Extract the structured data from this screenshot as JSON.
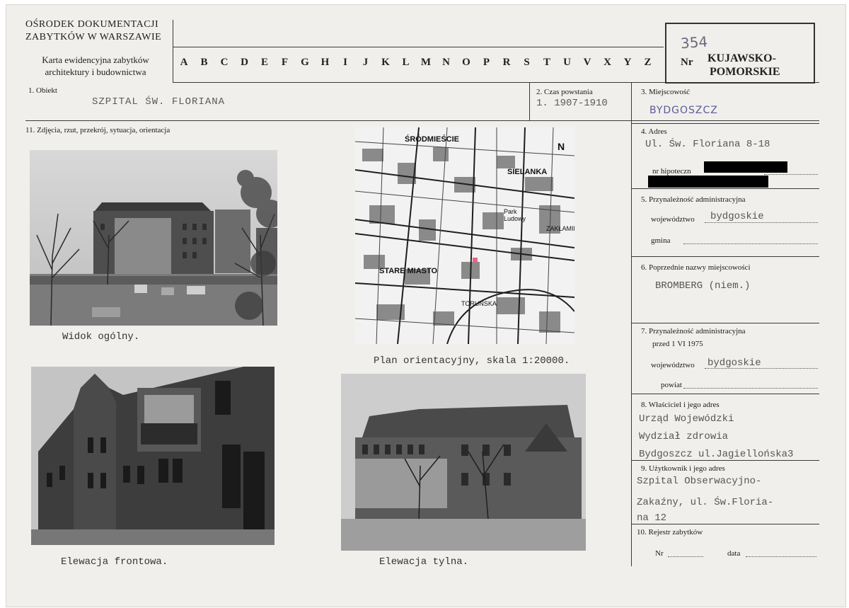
{
  "header": {
    "institution_line1": "OŚRODEK DOKUMENTACJI",
    "institution_line2": "ZABYTKÓW W WARSZAWIE",
    "card_type_line1": "Karta ewidencyjna zabytków",
    "card_type_line2": "architektury i budownictwa",
    "alphabet": [
      "A",
      "B",
      "C",
      "D",
      "E",
      "F",
      "G",
      "H",
      "I",
      "J",
      "K",
      "L",
      "M",
      "N",
      "O",
      "P",
      "R",
      "S",
      "T",
      "U",
      "V",
      "X",
      "Y",
      "Z"
    ],
    "nr_label": "Nr",
    "handwritten_number": "354",
    "region_line1": "KUJAWSKO-",
    "region_line2": "POMORSKIE"
  },
  "fields": {
    "obiekt_label": "1. Obiekt",
    "obiekt_value": "SZPITAL ŚW. FLORIANA",
    "czas_label": "2. Czas powstania",
    "czas_value": "1. 1907-1910",
    "miejscowosc_label": "3. Miejscowość",
    "miejscowosc_value": "BYDGOSZCZ",
    "zdjecia_label": "11. Zdjęcia, rzut, przekrój, sytuacja, orientacja",
    "adres_label": "4. Adres",
    "adres_value": "Ul. Św. Floriana 8-18",
    "hipoteczny_label": "nr hipoteczn",
    "przynaleznosc_label": "5. Przynależność administracyjna",
    "wojewodztwo_label": "województwo",
    "wojewodztwo_value": "bydgoskie",
    "gmina_label": "gmina",
    "poprzednie_label": "6. Poprzednie nazwy miejscowości",
    "poprzednie_value": "BROMBERG (niem.)",
    "przynaleznosc1975_label": "7. Przynależność administracyjna",
    "przed1975_label": "przed 1 VI 1975",
    "wojewodztwo2_label": "województwo",
    "wojewodztwo2_value": "bydgoskie",
    "powiat_label": "powiat",
    "wlasciciel_label": "8. Właściciel i jego adres",
    "wlasciciel_line1": "Urząd Wojewódzki",
    "wlasciciel_line2": "Wydział zdrowia",
    "wlasciciel_line3": "Bydgoszcz ul.Jagiellońska3",
    "uzytkownik_label": "9. Użytkownik i jego adres",
    "uzytkownik_line1": "Szpital Obserwacyjno-",
    "uzytkownik_line2": "Zakaźny, ul. Św.Floria-",
    "uzytkownik_line3": "na 12",
    "rejestr_label": "10. Rejestr zabytków",
    "rejestr_nr_label": "Nr",
    "rejestr_data_label": "data"
  },
  "captions": {
    "photo1": "Widok ogólny.",
    "map": "Plan orientacyjny, skala 1:20000.",
    "photo3": "Elewacja frontowa.",
    "photo4": "Elewacja tylna."
  },
  "map_labels": {
    "srodmiescie": "ŚRÓDMIEŚCIE",
    "sielanka": "SIELANKA",
    "park": "Park",
    "park2": "Ludowy",
    "stare_miasto": "STARE MIASTO",
    "zaklamies": "ZAKŁAMIES",
    "torunska": "TORUŃSKA",
    "north": "N"
  }
}
